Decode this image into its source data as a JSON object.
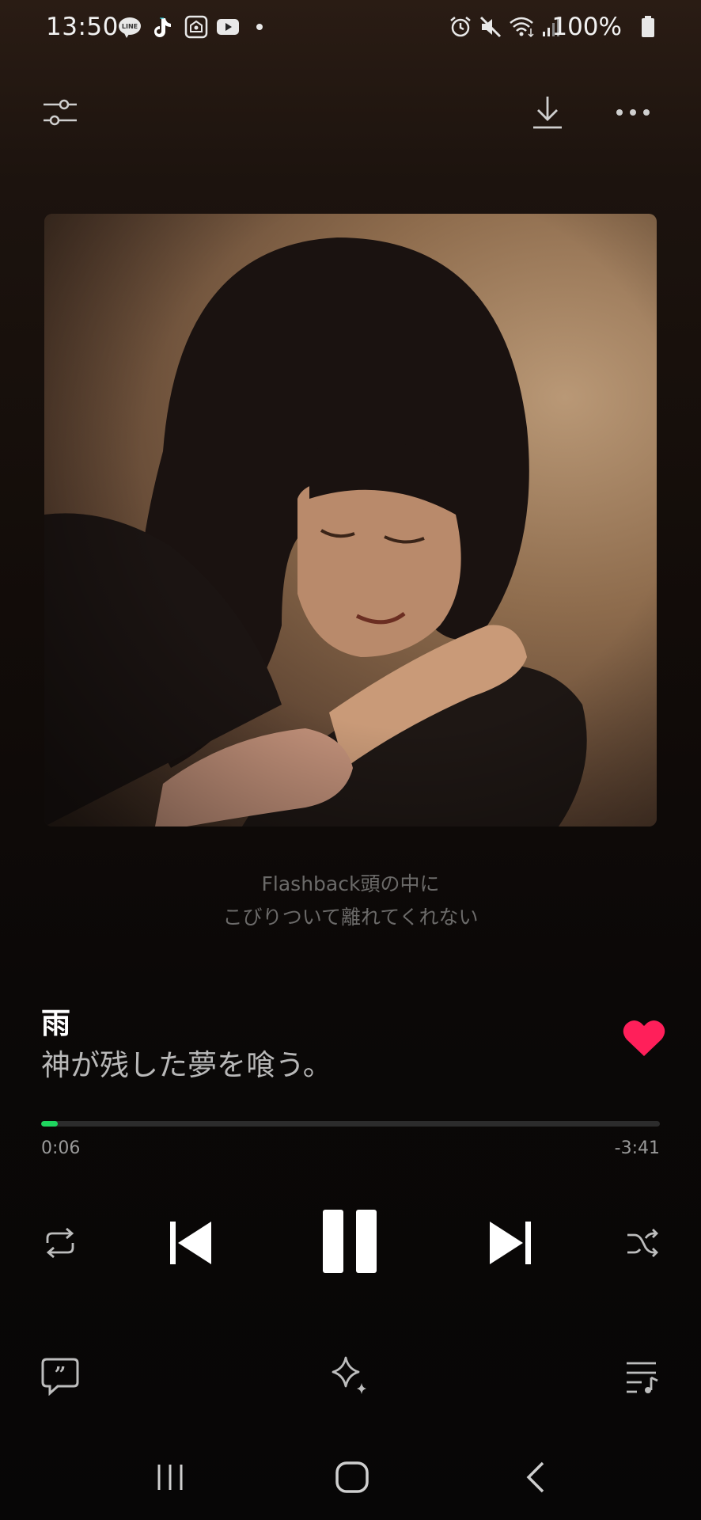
{
  "status_bar": {
    "time": "13:50",
    "battery": "100%",
    "left_icons": [
      "line-app-icon",
      "tiktok-icon",
      "home-app-icon",
      "youtube-icon",
      "dot-icon"
    ],
    "right_icons": [
      "alarm-icon",
      "mute-icon",
      "wifi-icon",
      "signal-icon",
      "battery-icon"
    ]
  },
  "top_bar": {
    "left_icon": "equalizer-icon",
    "right_icons": [
      "download-icon",
      "more-icon"
    ]
  },
  "lyrics": {
    "line1": "Flashback頭の中に",
    "line2": "こびりついて離れてくれない"
  },
  "track": {
    "title": "雨",
    "artist": "神が残した夢を喰う。",
    "liked": true
  },
  "progress": {
    "elapsed": "0:06",
    "remaining": "-3:41",
    "fraction": 0.027
  },
  "colors": {
    "accent_green": "#1fd65f",
    "like_red": "#ff1f5a"
  },
  "controls": [
    "repeat-icon",
    "previous-icon",
    "pause-icon",
    "next-icon",
    "shuffle-icon"
  ],
  "bottom_bar": [
    "lyrics-icon",
    "sparkle-icon",
    "queue-icon"
  ],
  "nav_bar": [
    "recent-apps-icon",
    "home-icon",
    "back-icon"
  ]
}
